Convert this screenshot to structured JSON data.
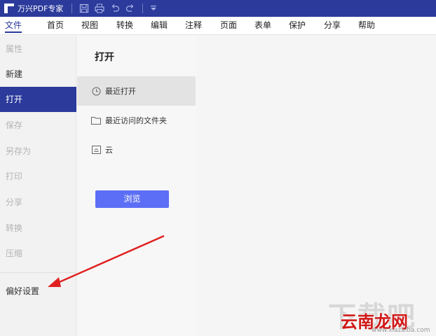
{
  "app": {
    "title": "万兴PDF专家"
  },
  "toolbar": {
    "icons": [
      "save-icon",
      "print-icon",
      "undo-icon",
      "redo-icon",
      "dropdown-icon"
    ]
  },
  "menu": {
    "items": [
      "文件",
      "首页",
      "视图",
      "转换",
      "编辑",
      "注释",
      "页面",
      "表单",
      "保护",
      "分享",
      "帮助"
    ],
    "active_index": 0
  },
  "sidebar": {
    "items": [
      {
        "label": "属性",
        "enabled": false
      },
      {
        "label": "新建",
        "enabled": true
      },
      {
        "label": "打开",
        "enabled": true,
        "selected": true
      },
      {
        "label": "保存",
        "enabled": false
      },
      {
        "label": "另存为",
        "enabled": false
      },
      {
        "label": "打印",
        "enabled": false
      },
      {
        "label": "分享",
        "enabled": false
      },
      {
        "label": "转换",
        "enabled": false
      },
      {
        "label": "压缩",
        "enabled": false
      },
      {
        "label": "偏好设置",
        "enabled": true
      }
    ]
  },
  "open_panel": {
    "title": "打开",
    "locations": [
      {
        "label": "最近打开",
        "icon": "clock-icon",
        "selected": true
      },
      {
        "label": "最近访问的文件夹",
        "icon": "folder-icon"
      },
      {
        "label": "云",
        "icon": "cloud-icon"
      }
    ],
    "browse_label": "浏览"
  },
  "watermark": {
    "big": "下载吧",
    "brand": "云南龙网",
    "url": "www.xiazaiba.com"
  },
  "colors": {
    "titlebar": "#2b3a9b",
    "selected": "#2b3a9b",
    "button": "#5b6ef5",
    "arrow": "#e02020"
  }
}
